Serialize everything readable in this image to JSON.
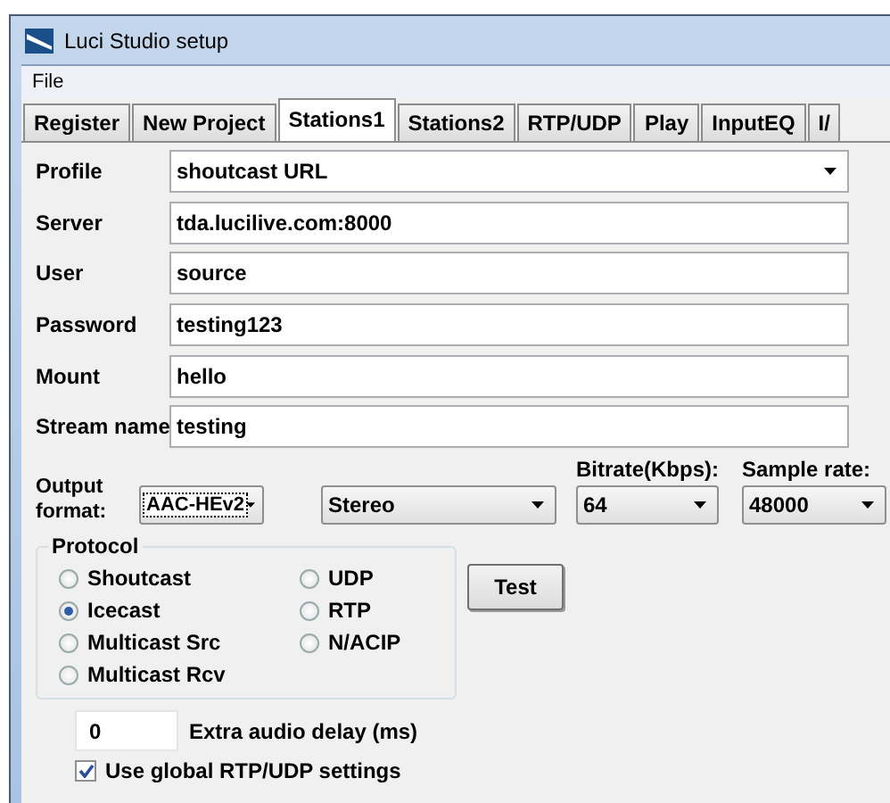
{
  "window": {
    "title": "Luci Studio setup"
  },
  "menu": [
    "File"
  ],
  "tabs": [
    {
      "label": "Register",
      "selected": false
    },
    {
      "label": "New Project",
      "selected": false
    },
    {
      "label": "Stations1",
      "selected": true
    },
    {
      "label": "Stations2",
      "selected": false
    },
    {
      "label": "RTP/UDP",
      "selected": false
    },
    {
      "label": "Play",
      "selected": false
    },
    {
      "label": "InputEQ",
      "selected": false
    },
    {
      "label": "I/",
      "selected": false
    }
  ],
  "fields": [
    {
      "label": "Profile",
      "kind": "dropdown",
      "value": "shoutcast URL"
    },
    {
      "label": "Server",
      "kind": "text",
      "value": "tda.lucilive.com:8000"
    },
    {
      "label": "User",
      "kind": "text",
      "value": "source"
    },
    {
      "label": "Password",
      "kind": "text",
      "value": "testing123"
    },
    {
      "label": "Mount",
      "kind": "text",
      "value": "hello"
    },
    {
      "label": "Stream name",
      "kind": "text",
      "value": "testing"
    }
  ],
  "output": {
    "label_1": "Output",
    "label_2": "format:",
    "format": "AAC-HEv2",
    "channels": "Stereo",
    "bitrate_label": "Bitrate(Kbps):",
    "bitrate": "64",
    "sample_rate_label": "Sample rate:",
    "sample_rate": "48000"
  },
  "protocol": {
    "title": "Protocol",
    "options": [
      {
        "label": "Shoutcast",
        "selected": false
      },
      {
        "label": "Icecast",
        "selected": true
      },
      {
        "label": "Multicast Src",
        "selected": false
      },
      {
        "label": "Multicast Rcv",
        "selected": false
      },
      {
        "label": "UDP",
        "selected": false
      },
      {
        "label": "RTP",
        "selected": false
      },
      {
        "label": "N/ACIP",
        "selected": false
      }
    ]
  },
  "test_button": "Test",
  "delay": {
    "value": "0",
    "label": "Extra audio delay (ms)"
  },
  "global_rtp": {
    "label": "Use global RTP/UDP settings",
    "checked": true
  }
}
